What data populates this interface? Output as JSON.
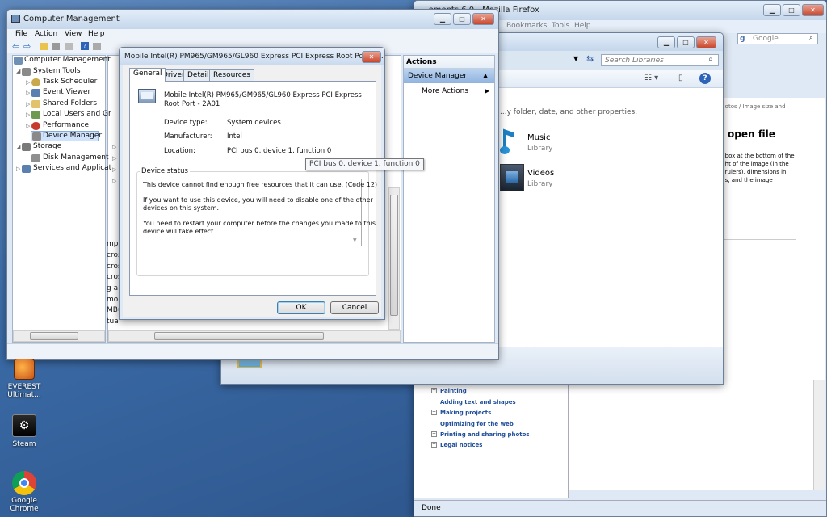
{
  "desktop": {
    "icons": [
      {
        "label_line1": "EVEREST",
        "label_line2": "Ultimat..."
      },
      {
        "label_line1": "Steam",
        "label_line2": ""
      },
      {
        "label_line1": "Google",
        "label_line2": "Chrome"
      }
    ]
  },
  "firefox": {
    "title": "...ements 6.0 - Mozilla Firefox",
    "menu": [
      "Bookmarks",
      "Tools",
      "Help"
    ],
    "search_placeholder": "Google",
    "breadcrumb": "...otos / Image size and",
    "heading": "open file",
    "para": [
      "...box at the bottom of the",
      "...ht of the image (in the",
      "...rulers), dimensions in",
      "...s, and the image"
    ],
    "help_items": [
      "Painting",
      "Adding text and shapes",
      "Making projects",
      "Optimizing for the web",
      "Printing and sharing photos",
      "Legal notices"
    ],
    "status": "Done"
  },
  "libraries": {
    "search_placeholder": "Search Libraries",
    "subtitle": "...y folder, date, and other properties.",
    "items": [
      {
        "name": "Music",
        "type": "Library"
      },
      {
        "name": "Videos",
        "type": "Library"
      }
    ]
  },
  "computer_management": {
    "title": "Computer Management",
    "menu": [
      "File",
      "Action",
      "View",
      "Help"
    ],
    "tree": [
      "Computer Management",
      "System Tools",
      "Task Scheduler",
      "Event Viewer",
      "Shared Folders",
      "Local Users and Gr",
      "Performance",
      "Device Manager",
      "Storage",
      "Disk Management",
      "Services and Applicat"
    ],
    "device_list_fragments": [
      "mp",
      "cros",
      "cros",
      "cros",
      "g a",
      "mo",
      "MBu",
      "tua"
    ],
    "actions_header": "Actions",
    "actions_section": "Device Manager",
    "actions_more": "More Actions"
  },
  "dialog": {
    "title": "Mobile Intel(R) PM965/GM965/GL960 Express PCI Express Root Port - 2...",
    "tabs": [
      "General",
      "Driver",
      "Details",
      "Resources"
    ],
    "device_name_line1": "Mobile Intel(R) PM965/GM965/GL960 Express PCI Express",
    "device_name_line2": "Root Port - 2A01",
    "device_type_label": "Device type:",
    "device_type_value": "System devices",
    "manufacturer_label": "Manufacturer:",
    "manufacturer_value": "Intel",
    "location_label": "Location:",
    "location_value": "PCI bus 0, device 1, function 0",
    "status_group": "Device status",
    "status_text": [
      "This device cannot find enough free resources that it can use. (Code 12)",
      "If you want to use this device, you will need to disable one of the other",
      "devices on this system.",
      "You need to restart your computer before the changes you made to this",
      "device will take effect."
    ],
    "ok": "OK",
    "cancel": "Cancel",
    "tooltip": "PCI bus 0, device 1, function 0"
  },
  "colors": {
    "accent": "#3a6aa5",
    "title_bar": "#c5d7ec",
    "selection": "#cfe3fc",
    "link": "#1f4e9a"
  }
}
